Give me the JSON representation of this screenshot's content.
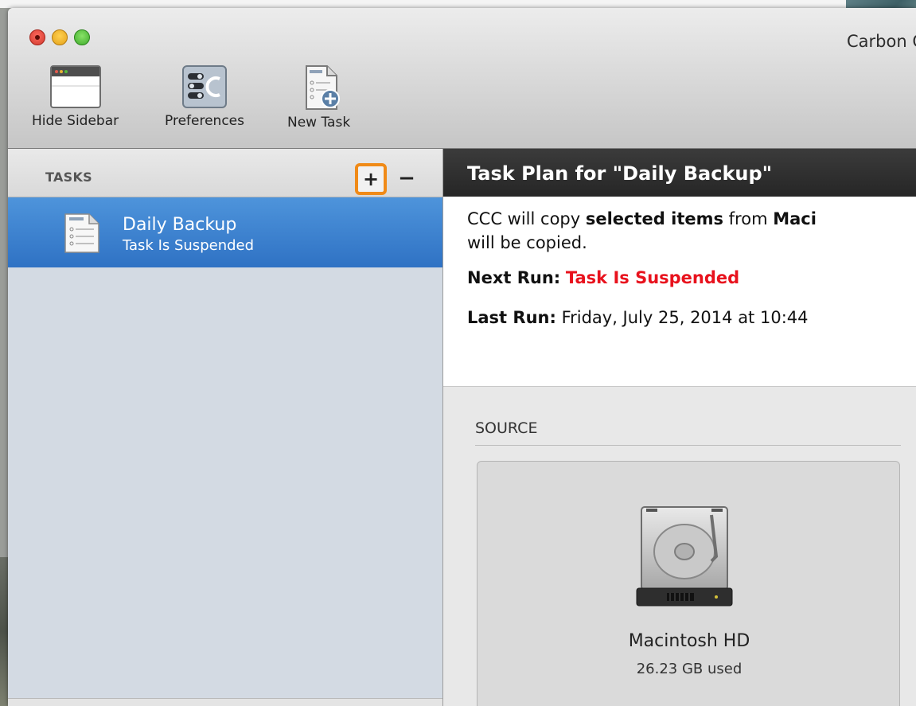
{
  "window": {
    "title": "Carbon Copy Cloner"
  },
  "toolbar": {
    "hide_sidebar": "Hide Sidebar",
    "preferences": "Preferences",
    "new_task": "New Task"
  },
  "sidebar": {
    "header": "TASKS",
    "add_label": "+",
    "remove_label": "−",
    "tasks": [
      {
        "name": "Daily Backup",
        "status": "Task Is Suspended"
      }
    ]
  },
  "plan": {
    "title": "Task Plan for \"Daily Backup\"",
    "line1_pre": "CCC will copy ",
    "line1_bold1": "selected items",
    "line1_mid": " from ",
    "line1_bold2": "Maci",
    "line2": "will be copied.",
    "next_run_label": "Next Run:",
    "next_run_value": "Task Is Suspended",
    "last_run_label": "Last Run:",
    "last_run_value": "Friday, July 25, 2014 at 10:44"
  },
  "source": {
    "label": "SOURCE",
    "volume_name": "Macintosh HD",
    "volume_used": "26.23 GB used"
  },
  "colors": {
    "accent_orange": "#f08a17",
    "selection_blue": "#3a7fd0",
    "suspended_red": "#e8121d"
  }
}
